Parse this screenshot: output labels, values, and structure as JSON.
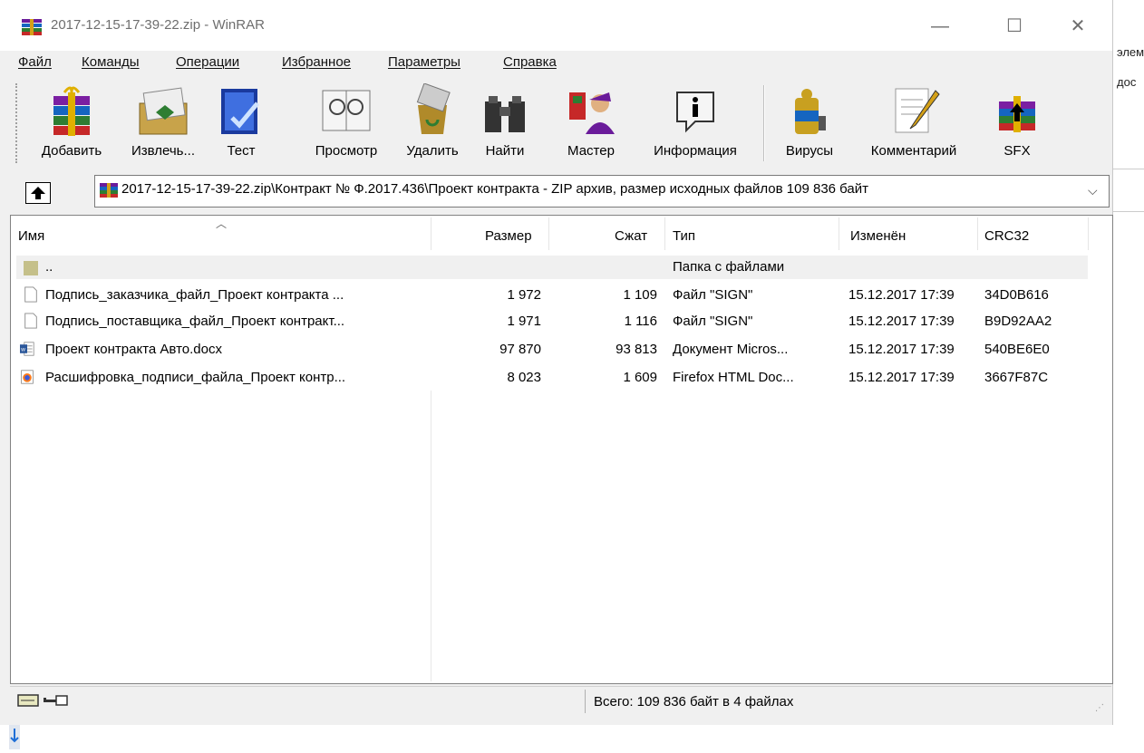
{
  "window": {
    "title": "2017-12-15-17-39-22.zip - WinRAR",
    "minimize": "—",
    "maximize": "☐",
    "close": "✕"
  },
  "menu": [
    "Файл",
    "Команды",
    "Операции",
    "Избранное",
    "Параметры",
    "Справка"
  ],
  "toolbar": {
    "add": "Добавить",
    "extract": "Извлечь...",
    "test": "Тест",
    "view": "Просмотр",
    "delete": "Удалить",
    "find": "Найти",
    "wizard": "Мастер",
    "info": "Информация",
    "viruses": "Вирусы",
    "comment": "Комментарий",
    "sfx": "SFX"
  },
  "address": {
    "path": "2017-12-15-17-39-22.zip\\Контракт № Ф.2017.436\\Проект контракта - ZIP архив, размер исходных файлов 109 836 байт"
  },
  "columns": {
    "name": "Имя",
    "size": "Размер",
    "packed": "Сжат",
    "type": "Тип",
    "modified": "Изменён",
    "crc": "CRC32"
  },
  "files": [
    {
      "name": "..",
      "size": "",
      "packed": "",
      "type": "Папка с файлами",
      "modified": "",
      "crc": "",
      "icon": "folder-icon"
    },
    {
      "name": "Подпись_заказчика_файл_Проект контракта ...",
      "size": "1 972",
      "packed": "1 109",
      "type": "Файл \"SIGN\"",
      "modified": "15.12.2017 17:39",
      "crc": "34D0B616",
      "icon": "blank-file-icon"
    },
    {
      "name": "Подпись_поставщика_файл_Проект контракт...",
      "size": "1 971",
      "packed": "1 116",
      "type": "Файл \"SIGN\"",
      "modified": "15.12.2017 17:39",
      "crc": "B9D92AA2",
      "icon": "blank-file-icon"
    },
    {
      "name": "Проект контракта Авто.docx",
      "size": "97 870",
      "packed": "93 813",
      "type": "Документ Micros...",
      "modified": "15.12.2017 17:39",
      "crc": "540BE6E0",
      "icon": "word-doc-icon"
    },
    {
      "name": "Расшифровка_подписи_файла_Проект контр...",
      "size": "8 023",
      "packed": "1 609",
      "type": "Firefox HTML Doc...",
      "modified": "15.12.2017 17:39",
      "crc": "3667F87C",
      "icon": "firefox-html-icon"
    }
  ],
  "status": {
    "summary": "Всего: 109 836 байт в 4 файлах"
  },
  "background_fragments": [
    "элем",
    "доc"
  ]
}
